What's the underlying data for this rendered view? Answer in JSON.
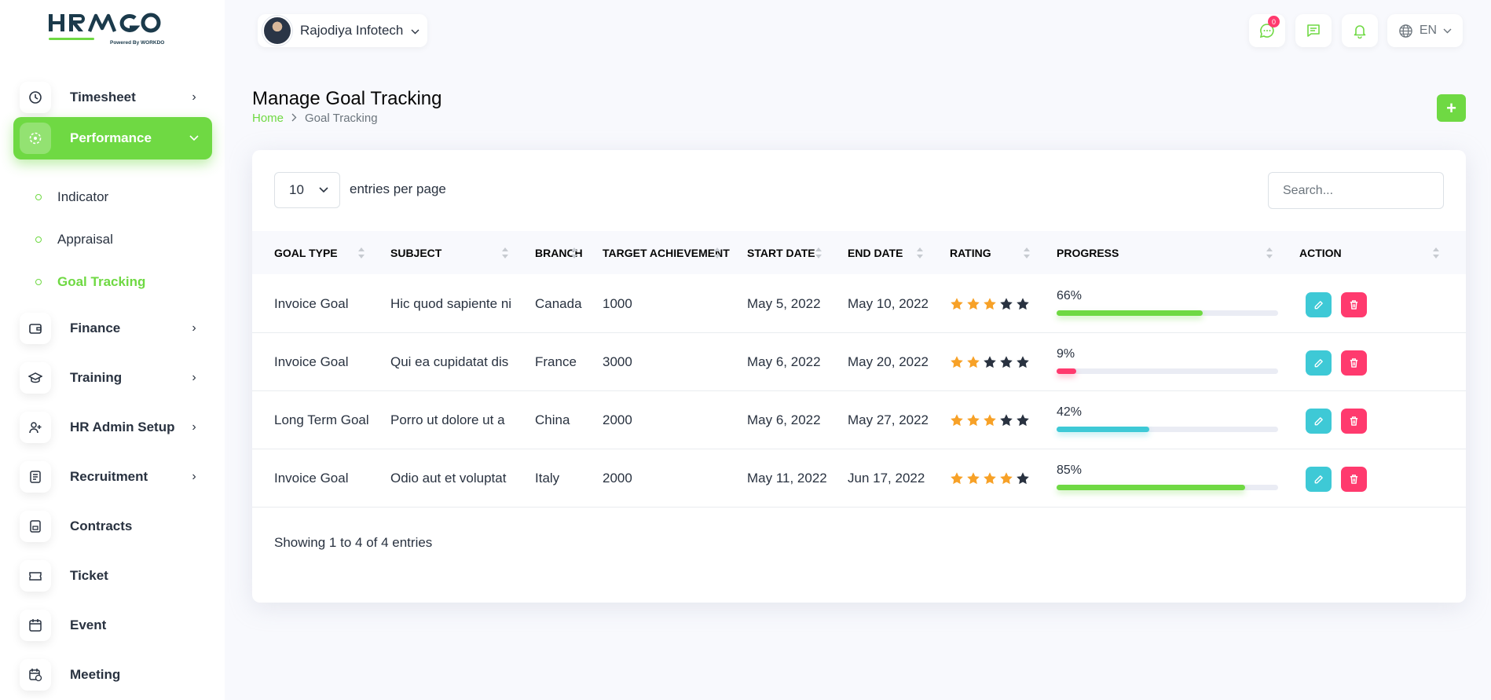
{
  "brand": {
    "logo_text": "HRMGO",
    "powered_by": "Powered By WORKDO",
    "accent": "#6fd943"
  },
  "sidebar": {
    "items": [
      {
        "label": "Timesheet",
        "icon": "clock-icon",
        "has_arrow": true
      },
      {
        "label": "Performance",
        "icon": "target-icon",
        "active": true,
        "expanded": true
      },
      {
        "label": "Finance",
        "icon": "wallet-icon",
        "has_arrow": true
      },
      {
        "label": "Training",
        "icon": "graduation-cap-icon",
        "has_arrow": true
      },
      {
        "label": "HR Admin Setup",
        "icon": "user-plus-icon",
        "has_arrow": true
      },
      {
        "label": "Recruitment",
        "icon": "clipboard-icon",
        "has_arrow": true
      },
      {
        "label": "Contracts",
        "icon": "document-icon"
      },
      {
        "label": "Ticket",
        "icon": "ticket-icon"
      },
      {
        "label": "Event",
        "icon": "calendar-icon"
      },
      {
        "label": "Meeting",
        "icon": "calendar-clock-icon"
      }
    ],
    "performance_sub": [
      {
        "label": "Indicator"
      },
      {
        "label": "Appraisal"
      },
      {
        "label": "Goal Tracking",
        "active": true
      }
    ]
  },
  "header": {
    "company": "Rajodiya Infotech",
    "messenger_badge": "0",
    "language": "EN"
  },
  "page": {
    "title": "Manage Goal Tracking",
    "breadcrumb_home": "Home",
    "breadcrumb_current": "Goal Tracking",
    "add_label": "+"
  },
  "table": {
    "per_page": "10",
    "per_page_label": "entries per page",
    "search_placeholder": "Search...",
    "columns": [
      "GOAL TYPE",
      "SUBJECT",
      "BRANCH",
      "TARGET ACHIEVEMENT",
      "START DATE",
      "END DATE",
      "RATING",
      "PROGRESS",
      "ACTION"
    ],
    "rows": [
      {
        "goal_type": "Invoice Goal",
        "subject": "Hic quod sapiente ni",
        "branch": "Canada",
        "target": "1000",
        "start": "May 5, 2022",
        "end": "May 10, 2022",
        "rating": 3,
        "progress": 66,
        "progress_label": "66%",
        "progress_color": "#6fd943"
      },
      {
        "goal_type": "Invoice Goal",
        "subject": "Qui ea cupidatat dis",
        "branch": "France",
        "target": "3000",
        "start": "May 6, 2022",
        "end": "May 20, 2022",
        "rating": 2,
        "progress": 9,
        "progress_label": "9%",
        "progress_color": "#ff3a6e"
      },
      {
        "goal_type": "Long Term Goal",
        "subject": "Porro ut dolore ut a",
        "branch": "China",
        "target": "2000",
        "start": "May 6, 2022",
        "end": "May 27, 2022",
        "rating": 3,
        "progress": 42,
        "progress_label": "42%",
        "progress_color": "#3ec9d6"
      },
      {
        "goal_type": "Invoice Goal",
        "subject": "Odio aut et voluptat",
        "branch": "Italy",
        "target": "2000",
        "start": "May 11, 2022",
        "end": "Jun 17, 2022",
        "rating": 4,
        "progress": 85,
        "progress_label": "85%",
        "progress_color": "#6fd943"
      }
    ],
    "footer": "Showing 1 to 4 of 4 entries",
    "star_filled_color": "#f7a127",
    "star_empty_color": "#293240"
  }
}
